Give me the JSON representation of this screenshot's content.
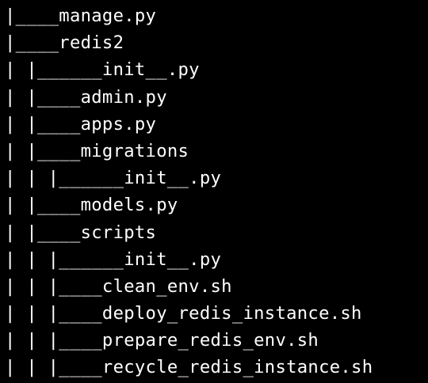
{
  "terminal": {
    "lines": [
      "|____manage.py",
      "|____redis2",
      "| |______init__.py",
      "| |____admin.py",
      "| |____apps.py",
      "| |____migrations",
      "| | |______init__.py",
      "| |____models.py",
      "| |____scripts",
      "| | |______init__.py",
      "| | |____clean_env.sh",
      "| | |____deploy_redis_instance.sh",
      "| | |____prepare_redis_env.sh",
      "| | |____recycle_redis_instance.sh"
    ]
  },
  "colors": {
    "background": "#000000",
    "text": "#ffffff"
  }
}
